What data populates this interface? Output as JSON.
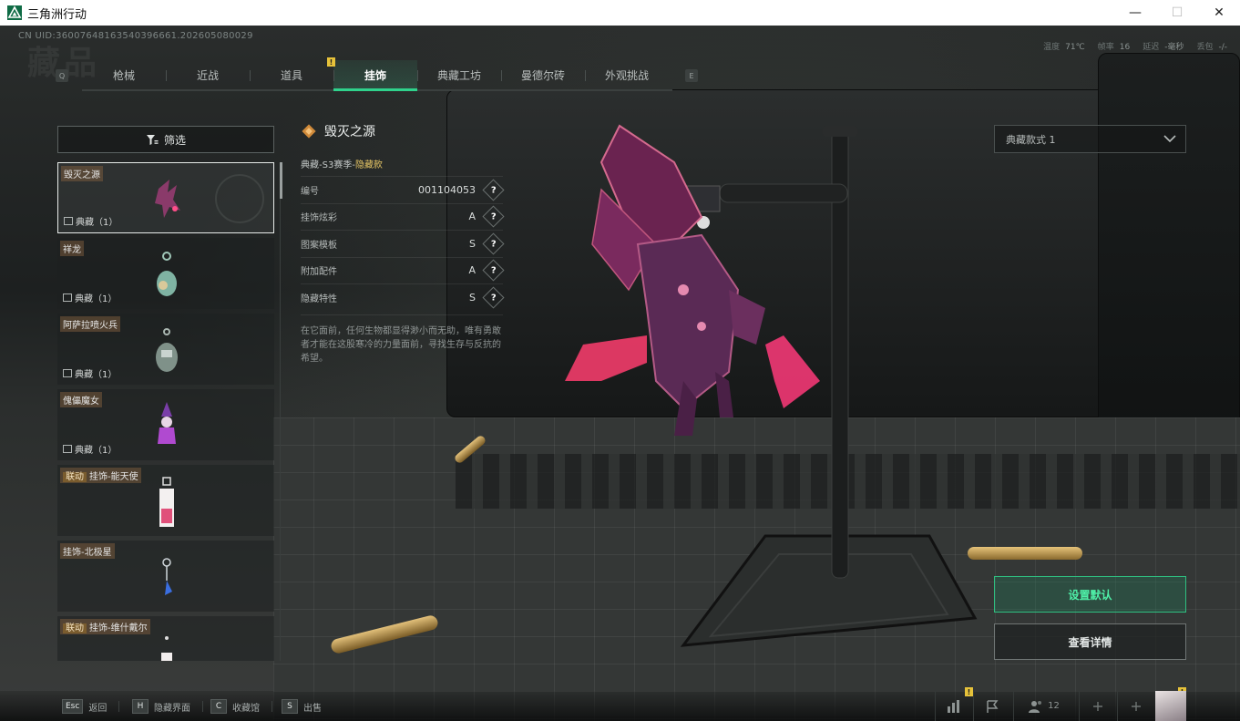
{
  "window": {
    "title": "三角洲行动",
    "controls": [
      "—",
      "☐",
      "✕"
    ]
  },
  "hud": {
    "uid": "CN UID:36007648163540396661.202605080029",
    "stats": [
      {
        "label": "温度",
        "value": "71℃"
      },
      {
        "label": "帧率",
        "value": "16"
      },
      {
        "label": "延迟",
        "value": "-毫秒"
      },
      {
        "label": "丢包",
        "value": "-/-"
      }
    ],
    "watermark": "藏品"
  },
  "tabs": {
    "prev_key": "Q",
    "next_key": "E",
    "items": [
      {
        "label": "枪械"
      },
      {
        "label": "近战"
      },
      {
        "label": "道具"
      },
      {
        "label": "挂饰",
        "active": true
      },
      {
        "label": "典藏工坊"
      },
      {
        "label": "曼德尔砖"
      },
      {
        "label": "外观挑战"
      }
    ],
    "new_badge": "!"
  },
  "filter": {
    "label": "筛选"
  },
  "list": {
    "items": [
      {
        "name": "毁灭之源",
        "kind": "典藏（1）",
        "selected": true
      },
      {
        "name": "祥龙",
        "kind": "典藏（1）"
      },
      {
        "name": "阿萨拉喷火兵",
        "kind": "典藏（1）"
      },
      {
        "name": "傀儡魔女",
        "kind": "典藏（1）"
      },
      {
        "tag": "联动",
        "name": "挂饰-能天使"
      },
      {
        "name": "挂饰-北极星"
      },
      {
        "tag": "联动",
        "name": "挂饰-维什戴尔"
      }
    ]
  },
  "detail": {
    "title": "毁灭之源",
    "sub_prefix": "典藏-S3赛季-",
    "sub_hidden": "隐藏款",
    "rows": [
      {
        "label": "编号",
        "value": "001104053",
        "help": "?"
      },
      {
        "label": "挂饰炫彩",
        "value": "A",
        "help": "?"
      },
      {
        "label": "图案模板",
        "value": "S",
        "help": "?"
      },
      {
        "label": "附加配件",
        "value": "A",
        "help": "?"
      },
      {
        "label": "隐藏特性",
        "value": "S",
        "help": "?"
      }
    ],
    "description": "在它面前，任何生物都显得渺小而无助，唯有勇敢者才能在这股寒冷的力量面前，寻找生存与反抗的希望。"
  },
  "variant": {
    "selected": "典藏款式 1"
  },
  "actions": {
    "set_default": "设置默认",
    "view_detail": "查看详情"
  },
  "bottom": {
    "hints": [
      {
        "key": "Esc",
        "label": "返回"
      },
      {
        "key": "H",
        "label": "隐藏界面"
      },
      {
        "key": "C",
        "label": "收藏馆"
      },
      {
        "key": "S",
        "label": "出售"
      }
    ],
    "friends_count": "12",
    "dock_badge": "!"
  },
  "colors": {
    "accent": "#2fd28c",
    "hidden_gold": "#e7c766",
    "badge_yellow": "#e6c23a"
  }
}
